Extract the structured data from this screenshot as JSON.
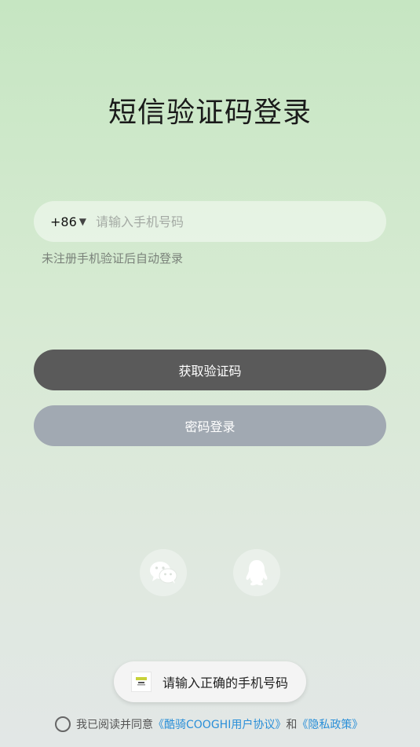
{
  "page": {
    "title": "短信验证码登录"
  },
  "phone": {
    "country_code": "+86",
    "dropdown_arrow": "▼",
    "placeholder": "请输入手机号码",
    "value": ""
  },
  "hint": "未注册手机验证后自动登录",
  "buttons": {
    "get_code": "获取验证码",
    "password_login": "密码登录"
  },
  "social": {
    "wechat_icon": "wechat-icon",
    "qq_icon": "qq-icon"
  },
  "toast": {
    "text": "请输入正确的手机号码"
  },
  "agreement": {
    "prefix": "我已阅读并同意",
    "user_agreement": "《酷骑COOGHI用户协议》",
    "and": "和",
    "privacy_policy": "《隐私政策》",
    "checked": false
  },
  "colors": {
    "primary_button": "#5a5a5a",
    "secondary_button": "#a1a9b2",
    "link": "#2a8fd8"
  }
}
